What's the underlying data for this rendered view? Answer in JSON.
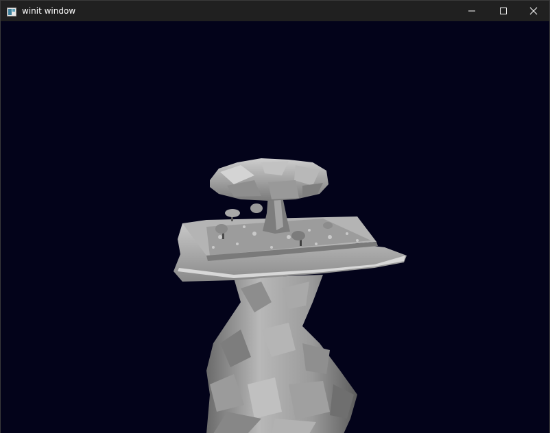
{
  "window": {
    "title": "winit window",
    "icons": {
      "app": "app-window-icon",
      "minimize": "minimize-icon",
      "maximize": "maximize-icon",
      "close": "close-icon"
    }
  },
  "scene": {
    "background_color": "#03031a",
    "model_color": "#a8a8a8",
    "description_icon": "floating-island-with-tree"
  }
}
